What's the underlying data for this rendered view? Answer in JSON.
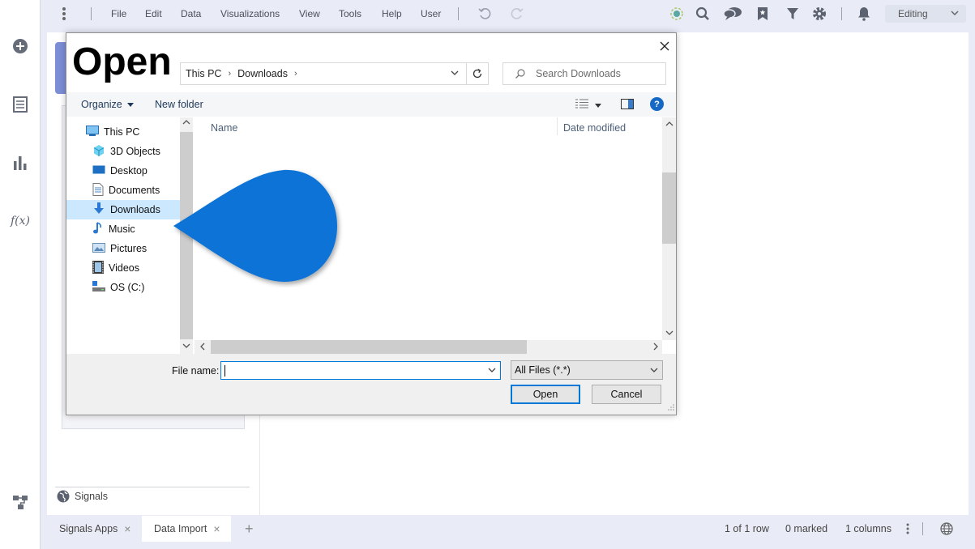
{
  "menubar": {
    "items": [
      "File",
      "Edit",
      "Data",
      "Visualizations",
      "View",
      "Tools",
      "Help",
      "User"
    ],
    "mode": "Editing"
  },
  "left_rail": {
    "icons": [
      "add-icon",
      "data-table-icon",
      "bar-chart-icon",
      "function-icon",
      "hierarchy-icon"
    ],
    "function_label": "f(x)"
  },
  "main": {
    "signals_label": "Signals"
  },
  "bottom_bar": {
    "tabs": [
      "Signals Apps",
      "Data Import"
    ],
    "add_tab": "+",
    "rows": "1 of 1 row",
    "marked": "0 marked",
    "columns": "1 columns"
  },
  "dialog": {
    "title": "Open",
    "breadcrumb": [
      "This PC",
      "Downloads"
    ],
    "search_placeholder": "Search Downloads",
    "organize": "Organize",
    "new_folder": "New folder",
    "help": "?",
    "nav": [
      {
        "label": "This PC",
        "icon": "computer-icon"
      },
      {
        "label": "3D Objects",
        "icon": "cube-icon"
      },
      {
        "label": "Desktop",
        "icon": "desktop-icon"
      },
      {
        "label": "Documents",
        "icon": "document-icon"
      },
      {
        "label": "Downloads",
        "icon": "download-arrow-icon",
        "selected": true
      },
      {
        "label": "Music",
        "icon": "music-note-icon"
      },
      {
        "label": "Pictures",
        "icon": "pictures-icon"
      },
      {
        "label": "Videos",
        "icon": "film-icon"
      },
      {
        "label": "OS (C:)",
        "icon": "drive-icon"
      }
    ],
    "columns": {
      "name": "Name",
      "date": "Date modified"
    },
    "file_name_label": "File name:",
    "file_name_value": "",
    "file_type": "All Files (*.*)",
    "open": "Open",
    "cancel": "Cancel"
  },
  "colors": {
    "accent": "#0078d7",
    "callout": "#0a73d6",
    "selected_nav": "#cce8ff",
    "app_background": "#e9ecf6"
  }
}
